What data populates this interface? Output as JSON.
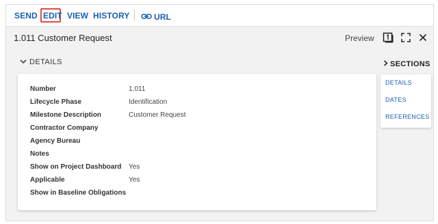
{
  "toolbar": {
    "send": "SEND",
    "edit": "EDIT",
    "view": "VIEW",
    "history": "HISTORY",
    "url": "URL",
    "url_icon": "link-icon"
  },
  "header": {
    "title": "1.011 Customer Request",
    "preview": "Preview",
    "icons": [
      "preview-one-icon",
      "expand-icon",
      "close-icon"
    ]
  },
  "details": {
    "toggle_label": "DETAILS",
    "fields": [
      {
        "label": "Number",
        "value": "1.011"
      },
      {
        "label": "Lifecycle Phase",
        "value": "Identification"
      },
      {
        "label": "Milestone Description",
        "value": "Customer Request"
      },
      {
        "label": "Contractor Company",
        "value": ""
      },
      {
        "label": "Agency Bureau",
        "value": ""
      },
      {
        "label": "Notes",
        "value": ""
      },
      {
        "label": "Show on Project Dashboard",
        "value": "Yes"
      },
      {
        "label": "Applicable",
        "value": "Yes"
      },
      {
        "label": "Show in Baseline Obligations",
        "value": ""
      }
    ]
  },
  "sections": {
    "title": "SECTIONS",
    "links": [
      "DETAILS",
      "DATES",
      "REFERENCES"
    ]
  },
  "colors": {
    "accent": "#1a5fb4",
    "highlight": "#e04a3c",
    "panel_bg": "#f2f2f2"
  }
}
